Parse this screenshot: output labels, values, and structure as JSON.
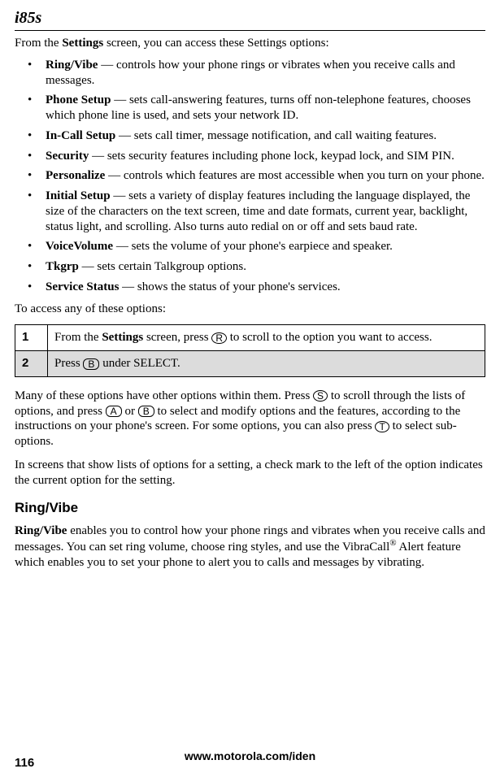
{
  "header": {
    "model": "i85s"
  },
  "intro": {
    "prefix": "From the ",
    "bold": "Settings",
    "suffix": " screen, you can access these Settings options:"
  },
  "bullets": [
    {
      "term": "Ring/Vibe",
      "desc": " — controls how your phone rings or vibrates when you receive calls and messages."
    },
    {
      "term": "Phone Setup",
      "desc": " — sets call-answering features, turns off non-telephone features, chooses which phone line is used, and sets your network ID."
    },
    {
      "term": "In-Call Setup",
      "desc": " — sets call timer, message notification, and call waiting features."
    },
    {
      "term": "Security",
      "desc": " — sets security features including phone lock, keypad lock, and SIM PIN."
    },
    {
      "term": "Personalize",
      "desc": " — controls which features are most accessible when you turn on your phone."
    },
    {
      "term": "Initial Setup",
      "desc": " — sets a variety of display features including the language displayed, the size of the characters on the text screen, time and date formats, current year, backlight, status light, and scrolling. Also turns auto redial on or off and sets baud rate."
    },
    {
      "term": "VoiceVolume",
      "desc": " — sets the volume of your phone's earpiece and speaker."
    },
    {
      "term": "Tkgrp",
      "desc": " — sets certain Talkgroup options."
    },
    {
      "term": "Service Status",
      "desc": " — shows the status of your phone's services."
    }
  ],
  "access_line": "To access any of these options:",
  "steps": {
    "row1": {
      "num": "1",
      "prefix": "From the ",
      "bold": "Settings",
      "mid": " screen, press ",
      "glyph": "R",
      "suffix": " to scroll to the option you want to access."
    },
    "row2": {
      "num": "2",
      "prefix": "Press ",
      "glyph": "B",
      "suffix": " under SELECT."
    }
  },
  "para_after": {
    "p1a": "Many of these options have other options within them. Press ",
    "g1": "S",
    "p1b": " to scroll through the lists of options, and press ",
    "g2": "A",
    "p1c": " or ",
    "g3": "B",
    "p1d": " to select and modify options and the features, according to the instructions on your phone's screen. For some options, you can also press ",
    "g4": "T",
    "p1e": " to select sub-options.",
    "p2": "In screens that show lists of options for a setting, a check mark to the left of the option indicates the current option for the setting."
  },
  "section": {
    "heading": "Ring/Vibe",
    "para_prefix": "Ring/Vibe",
    "para_mid1": " enables you to control how your phone rings and vibrates when you receive calls and messages. You can set ring volume, choose ring styles, and use the VibraCall",
    "reg": "®",
    "para_mid2": " Alert feature which enables you to set your phone to alert you to calls and messages by vibrating."
  },
  "footer": {
    "url": "www.motorola.com/iden",
    "page": "116"
  }
}
